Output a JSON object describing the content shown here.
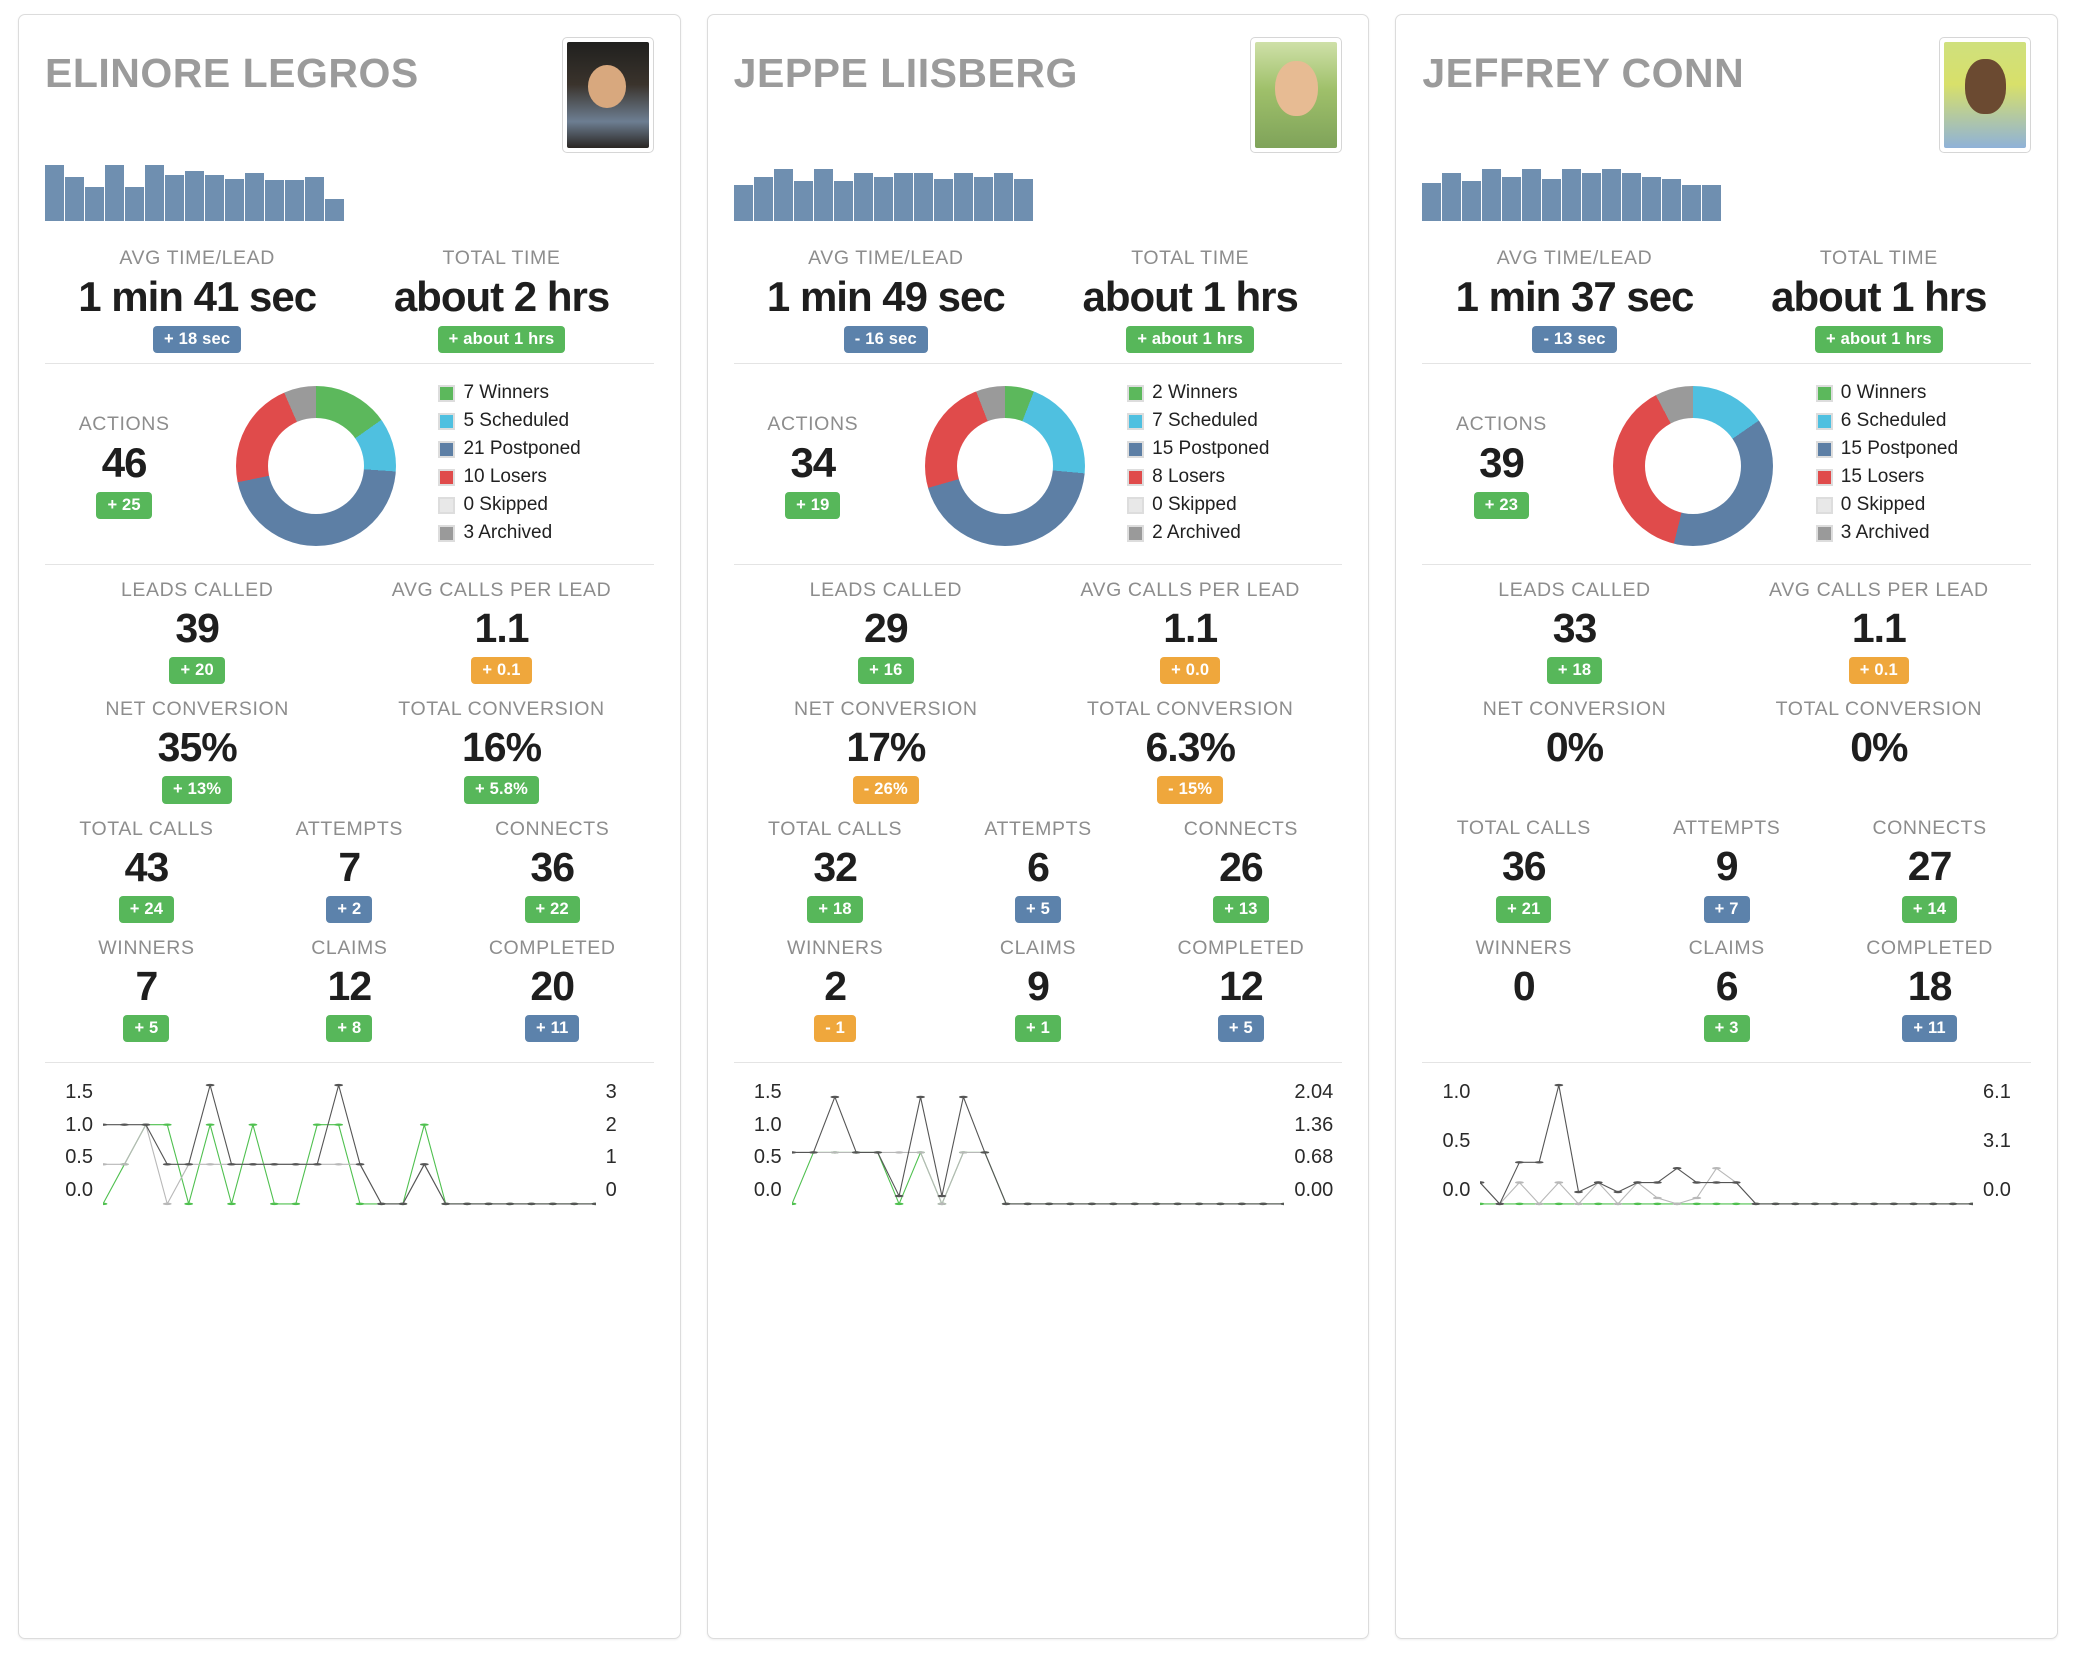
{
  "colors": {
    "green": "#57b75a",
    "blue": "#5c82ab",
    "orange": "#efa73c",
    "donut_winners": "#5cb85c",
    "donut_scheduled": "#4fc0e0",
    "donut_postponed": "#5d7fa5",
    "donut_losers": "#e04b4b",
    "donut_skipped": "#e8e8e8",
    "donut_archived": "#9a9a9a",
    "bar": "#6f8fb0",
    "line_green": "#4fc04f",
    "line_lightgray": "#b8b8b8",
    "line_darkgray": "#555555"
  },
  "cards": [
    {
      "name": "ELINORE LEGROS",
      "avatar": "avatar-photo",
      "sparkline": [
        56,
        44,
        34,
        56,
        34,
        56,
        46,
        50,
        46,
        42,
        48,
        41,
        41,
        44,
        22
      ],
      "time": {
        "avg_label": "AVG TIME/LEAD",
        "avg_value": "1 min 41 sec",
        "avg_delta": "+ 18 sec",
        "avg_delta_color": "blue",
        "total_label": "TOTAL TIME",
        "total_value": "about 2 hrs",
        "total_delta": "+ about 1 hrs",
        "total_delta_color": "green"
      },
      "actions": {
        "label": "ACTIONS",
        "value": "46",
        "delta": "+ 25",
        "delta_color": "green",
        "legend": [
          {
            "count": 7,
            "label": "7 Winners",
            "color": "#5cb85c"
          },
          {
            "count": 5,
            "label": "5 Scheduled",
            "color": "#4fc0e0"
          },
          {
            "count": 21,
            "label": "21 Postponed",
            "color": "#5d7fa5"
          },
          {
            "count": 10,
            "label": "10 Losers",
            "color": "#e04b4b"
          },
          {
            "count": 0,
            "label": "0 Skipped",
            "color": "#e8e8e8"
          },
          {
            "count": 3,
            "label": "3 Archived",
            "color": "#9a9a9a"
          }
        ]
      },
      "stats": [
        [
          {
            "label": "LEADS CALLED",
            "value": "39",
            "delta": "+ 20",
            "color": "green"
          },
          {
            "label": "AVG CALLS PER LEAD",
            "value": "1.1",
            "delta": "+ 0.1",
            "color": "orange"
          }
        ],
        [
          {
            "label": "NET CONVERSION",
            "value": "35%",
            "delta": "+ 13%",
            "color": "green"
          },
          {
            "label": "TOTAL CONVERSION",
            "value": "16%",
            "delta": "+ 5.8%",
            "color": "green"
          }
        ],
        [
          {
            "label": "TOTAL CALLS",
            "value": "43",
            "delta": "+ 24",
            "color": "green"
          },
          {
            "label": "ATTEMPTS",
            "value": "7",
            "delta": "+ 2",
            "color": "blue"
          },
          {
            "label": "CONNECTS",
            "value": "36",
            "delta": "+ 22",
            "color": "green"
          }
        ],
        [
          {
            "label": "WINNERS",
            "value": "7",
            "delta": "+ 5",
            "color": "green"
          },
          {
            "label": "CLAIMS",
            "value": "12",
            "delta": "+ 8",
            "color": "green"
          },
          {
            "label": "COMPLETED",
            "value": "20",
            "delta": "+ 11",
            "color": "blue"
          }
        ]
      ],
      "chart_data": {
        "type": "line",
        "left_ticks": [
          "1.5",
          "1.0",
          "0.5",
          "0.0"
        ],
        "right_ticks": [
          "3",
          "2",
          "1",
          "0"
        ],
        "ylim": [
          0,
          1.5
        ],
        "series": [
          {
            "name": "green",
            "color": "#4fc04f",
            "values": [
              0,
              0.5,
              1,
              1,
              0,
              1,
              0,
              1,
              0,
              0,
              1,
              1,
              0,
              0,
              0,
              1,
              0,
              0,
              0,
              0,
              0,
              0,
              0,
              0
            ]
          },
          {
            "name": "light-gray",
            "color": "#b8b8b8",
            "values": [
              0.5,
              0.5,
              1,
              0,
              0.5,
              0.5,
              0.5,
              0.5,
              0.5,
              0.5,
              0.5,
              0.5,
              0.5,
              0,
              0,
              0.5,
              0,
              0,
              0,
              0,
              0,
              0,
              0,
              0
            ]
          },
          {
            "name": "dark-gray",
            "color": "#555555",
            "values": [
              1,
              1,
              1,
              0.5,
              0.5,
              1.5,
              0.5,
              0.5,
              0.5,
              0.5,
              0.5,
              1.5,
              0.5,
              0,
              0,
              0.5,
              0,
              0,
              0,
              0,
              0,
              0,
              0,
              0
            ]
          }
        ]
      }
    },
    {
      "name": "JEPPE LIISBERG",
      "avatar": "avatar-photo",
      "sparkline": [
        36,
        44,
        52,
        40,
        52,
        40,
        48,
        44,
        48,
        48,
        42,
        48,
        44,
        48,
        42
      ],
      "time": {
        "avg_label": "AVG TIME/LEAD",
        "avg_value": "1 min 49 sec",
        "avg_delta": "- 16 sec",
        "avg_delta_color": "blue",
        "total_label": "TOTAL TIME",
        "total_value": "about 1 hrs",
        "total_delta": "+ about 1 hrs",
        "total_delta_color": "green"
      },
      "actions": {
        "label": "ACTIONS",
        "value": "34",
        "delta": "+ 19",
        "delta_color": "green",
        "legend": [
          {
            "count": 2,
            "label": "2 Winners",
            "color": "#5cb85c"
          },
          {
            "count": 7,
            "label": "7 Scheduled",
            "color": "#4fc0e0"
          },
          {
            "count": 15,
            "label": "15 Postponed",
            "color": "#5d7fa5"
          },
          {
            "count": 8,
            "label": "8 Losers",
            "color": "#e04b4b"
          },
          {
            "count": 0,
            "label": "0 Skipped",
            "color": "#e8e8e8"
          },
          {
            "count": 2,
            "label": "2 Archived",
            "color": "#9a9a9a"
          }
        ]
      },
      "stats": [
        [
          {
            "label": "LEADS CALLED",
            "value": "29",
            "delta": "+ 16",
            "color": "green"
          },
          {
            "label": "AVG CALLS PER LEAD",
            "value": "1.1",
            "delta": "+ 0.0",
            "color": "orange"
          }
        ],
        [
          {
            "label": "NET CONVERSION",
            "value": "17%",
            "delta": "- 26%",
            "color": "orange"
          },
          {
            "label": "TOTAL CONVERSION",
            "value": "6.3%",
            "delta": "- 15%",
            "color": "orange"
          }
        ],
        [
          {
            "label": "TOTAL CALLS",
            "value": "32",
            "delta": "+ 18",
            "color": "green"
          },
          {
            "label": "ATTEMPTS",
            "value": "6",
            "delta": "+ 5",
            "color": "blue"
          },
          {
            "label": "CONNECTS",
            "value": "26",
            "delta": "+ 13",
            "color": "green"
          }
        ],
        [
          {
            "label": "WINNERS",
            "value": "2",
            "delta": "- 1",
            "color": "orange"
          },
          {
            "label": "CLAIMS",
            "value": "9",
            "delta": "+ 1",
            "color": "green"
          },
          {
            "label": "COMPLETED",
            "value": "12",
            "delta": "+ 5",
            "color": "blue"
          }
        ]
      ],
      "chart_data": {
        "type": "line",
        "left_ticks": [
          "1.5",
          "1.0",
          "0.5",
          "0.0"
        ],
        "right_ticks": [
          "2.04",
          "1.36",
          "0.68",
          "0.00"
        ],
        "ylim": [
          0,
          1.5
        ],
        "series": [
          {
            "name": "green",
            "color": "#4fc04f",
            "values": [
              0,
              0.65,
              0.65,
              0.65,
              0.65,
              0,
              0.65,
              0,
              0.65,
              0.65,
              0,
              0,
              0,
              0,
              0,
              0,
              0,
              0,
              0,
              0,
              0,
              0,
              0,
              0
            ]
          },
          {
            "name": "light-gray",
            "color": "#b8b8b8",
            "values": [
              0.65,
              0.65,
              0.65,
              0.65,
              0.65,
              0.65,
              0.65,
              0,
              0.65,
              0.65,
              0,
              0,
              0,
              0,
              0,
              0,
              0,
              0,
              0,
              0,
              0,
              0,
              0,
              0
            ]
          },
          {
            "name": "dark-gray",
            "color": "#555555",
            "values": [
              0.65,
              0.65,
              1.35,
              0.65,
              0.65,
              0.1,
              1.35,
              0.1,
              1.35,
              0.65,
              0,
              0,
              0,
              0,
              0,
              0,
              0,
              0,
              0,
              0,
              0,
              0,
              0,
              0
            ]
          }
        ]
      }
    },
    {
      "name": "JEFFREY CONN",
      "avatar": "avatar-photo",
      "sparkline": [
        38,
        48,
        40,
        52,
        44,
        52,
        42,
        52,
        48,
        52,
        48,
        44,
        42,
        36,
        36
      ],
      "time": {
        "avg_label": "AVG TIME/LEAD",
        "avg_value": "1 min 37 sec",
        "avg_delta": "- 13 sec",
        "avg_delta_color": "blue",
        "total_label": "TOTAL TIME",
        "total_value": "about 1 hrs",
        "total_delta": "+ about 1 hrs",
        "total_delta_color": "green"
      },
      "actions": {
        "label": "ACTIONS",
        "value": "39",
        "delta": "+ 23",
        "delta_color": "green",
        "legend": [
          {
            "count": 0,
            "label": "0 Winners",
            "color": "#5cb85c"
          },
          {
            "count": 6,
            "label": "6 Scheduled",
            "color": "#4fc0e0"
          },
          {
            "count": 15,
            "label": "15 Postponed",
            "color": "#5d7fa5"
          },
          {
            "count": 15,
            "label": "15 Losers",
            "color": "#e04b4b"
          },
          {
            "count": 0,
            "label": "0 Skipped",
            "color": "#e8e8e8"
          },
          {
            "count": 3,
            "label": "3 Archived",
            "color": "#9a9a9a"
          }
        ]
      },
      "stats": [
        [
          {
            "label": "LEADS CALLED",
            "value": "33",
            "delta": "+ 18",
            "color": "green"
          },
          {
            "label": "AVG CALLS PER LEAD",
            "value": "1.1",
            "delta": "+ 0.1",
            "color": "orange"
          }
        ],
        [
          {
            "label": "NET CONVERSION",
            "value": "0%",
            "delta": "",
            "color": "green"
          },
          {
            "label": "TOTAL CONVERSION",
            "value": "0%",
            "delta": "",
            "color": "green"
          }
        ],
        [
          {
            "label": "TOTAL CALLS",
            "value": "36",
            "delta": "+ 21",
            "color": "green"
          },
          {
            "label": "ATTEMPTS",
            "value": "9",
            "delta": "+ 7",
            "color": "blue"
          },
          {
            "label": "CONNECTS",
            "value": "27",
            "delta": "+ 14",
            "color": "green"
          }
        ],
        [
          {
            "label": "WINNERS",
            "value": "0",
            "delta": "",
            "color": "green"
          },
          {
            "label": "CLAIMS",
            "value": "6",
            "delta": "+ 3",
            "color": "green"
          },
          {
            "label": "COMPLETED",
            "value": "18",
            "delta": "+ 11",
            "color": "blue"
          }
        ]
      ],
      "chart_data": {
        "type": "line",
        "left_ticks": [
          "1.0",
          "0.5",
          "0.0"
        ],
        "right_ticks": [
          "6.1",
          "3.1",
          "0.0"
        ],
        "ylim": [
          0,
          1.0
        ],
        "series": [
          {
            "name": "green",
            "color": "#4fc04f",
            "values": [
              0,
              0,
              0,
              0,
              0,
              0,
              0,
              0,
              0,
              0,
              0,
              0,
              0,
              0,
              0,
              0,
              0,
              0,
              0,
              0,
              0,
              0,
              0,
              0,
              0,
              0
            ]
          },
          {
            "name": "light-gray",
            "color": "#b8b8b8",
            "values": [
              0.18,
              0,
              0.18,
              0,
              0.18,
              0,
              0.18,
              0,
              0.18,
              0.05,
              0,
              0.05,
              0.3,
              0.18,
              0,
              0,
              0,
              0,
              0,
              0,
              0,
              0,
              0,
              0,
              0,
              0
            ]
          },
          {
            "name": "dark-gray",
            "color": "#555555",
            "values": [
              0.18,
              0,
              0.35,
              0.35,
              1.0,
              0.1,
              0.18,
              0.1,
              0.18,
              0.18,
              0.3,
              0.18,
              0.18,
              0.18,
              0,
              0,
              0,
              0,
              0,
              0,
              0,
              0,
              0,
              0,
              0,
              0
            ]
          }
        ]
      }
    }
  ]
}
